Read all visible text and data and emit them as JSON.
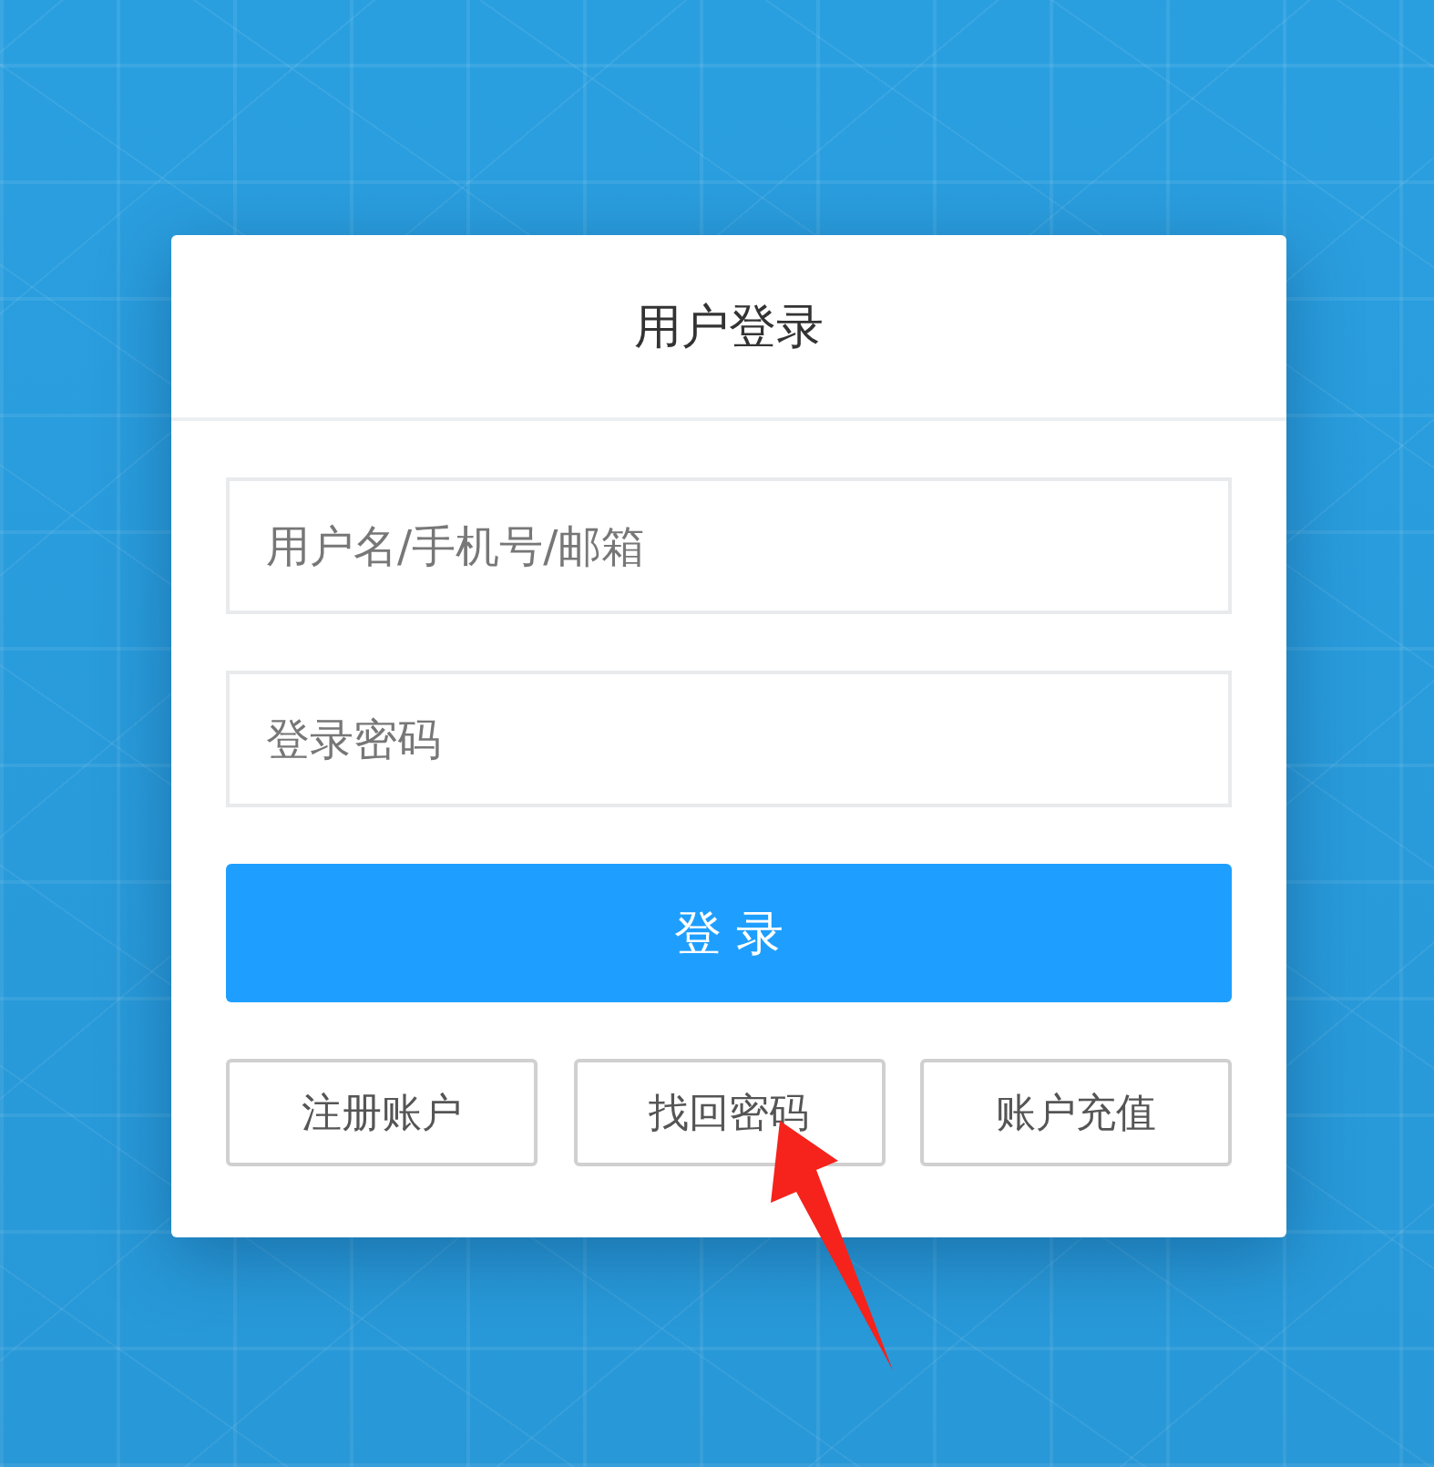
{
  "card": {
    "title": "用户登录"
  },
  "fields": [
    {
      "placeholder": "用户名/手机号/邮箱"
    },
    {
      "placeholder": "登录密码"
    }
  ],
  "submit_button": "登 录",
  "buttons": [
    "注册账户",
    "找回密码",
    "账户充值"
  ]
}
